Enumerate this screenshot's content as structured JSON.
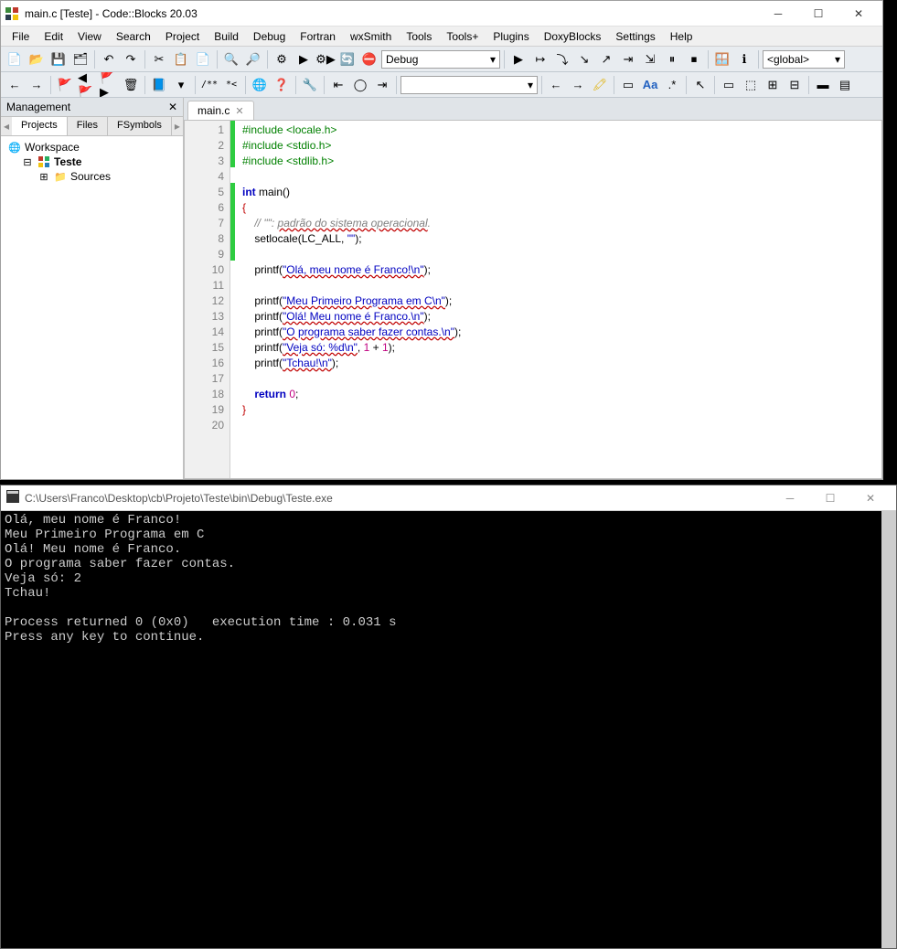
{
  "window": {
    "title": "main.c [Teste] - Code::Blocks 20.03"
  },
  "menu": {
    "items": [
      "File",
      "Edit",
      "View",
      "Search",
      "Project",
      "Build",
      "Debug",
      "Fortran",
      "wxSmith",
      "Tools",
      "Tools+",
      "Plugins",
      "DoxyBlocks",
      "Settings",
      "Help"
    ]
  },
  "toolbar2": {
    "build_target": "Debug",
    "scope": "<global>"
  },
  "management": {
    "title": "Management",
    "tabs": [
      "Projects",
      "Files",
      "FSymbols"
    ],
    "tree": {
      "workspace": "Workspace",
      "project": "Teste",
      "folder": "Sources"
    }
  },
  "editor": {
    "tab": "main.c",
    "lines": [
      "1",
      "2",
      "3",
      "4",
      "5",
      "6",
      "7",
      "8",
      "9",
      "10",
      "11",
      "12",
      "13",
      "14",
      "15",
      "16",
      "17",
      "18",
      "19",
      "20"
    ],
    "code": {
      "l1": "#include <locale.h>",
      "l2": "#include <stdio.h>",
      "l3": "#include <stdlib.h>",
      "l5a": "int",
      "l5b": " main",
      "l5c": "()",
      "l6": "{",
      "l7a": "    // \"\": ",
      "l7b": "padrão do sistema operacional",
      "l7c": ".",
      "l8a": "    setlocale(LC_ALL, ",
      "l8b": "\"\"",
      "l8c": ");",
      "l10a": "    printf(",
      "l10b": "\"Olá, meu nome é Franco!\\n\"",
      "l10c": ");",
      "l12a": "    printf(",
      "l12b": "\"Meu Primeiro Programa em C\\n\"",
      "l12c": ");",
      "l13a": "    printf(",
      "l13b": "\"Olá! Meu nome é Franco.\\n\"",
      "l13c": ");",
      "l14a": "    printf(",
      "l14b": "\"O programa saber fazer contas.\\n\"",
      "l14c": ");",
      "l15a": "    printf(",
      "l15b": "\"Veja só: %d\\n\"",
      "l15c": ", ",
      "l15d": "1",
      "l15e": " + ",
      "l15f": "1",
      "l15g": ");",
      "l16a": "    printf(",
      "l16b": "\"Tchau!\\n\"",
      "l16c": ");",
      "l18a": "    return ",
      "l18b": "0",
      "l18c": ";",
      "l19": "}"
    }
  },
  "console": {
    "title": "C:\\Users\\Franco\\Desktop\\cb\\Projeto\\Teste\\bin\\Debug\\Teste.exe",
    "output": "Olá, meu nome é Franco!\nMeu Primeiro Programa em C\nOlá! Meu nome é Franco.\nO programa saber fazer contas.\nVeja só: 2\nTchau!\n\nProcess returned 0 (0x0)   execution time : 0.031 s\nPress any key to continue."
  }
}
